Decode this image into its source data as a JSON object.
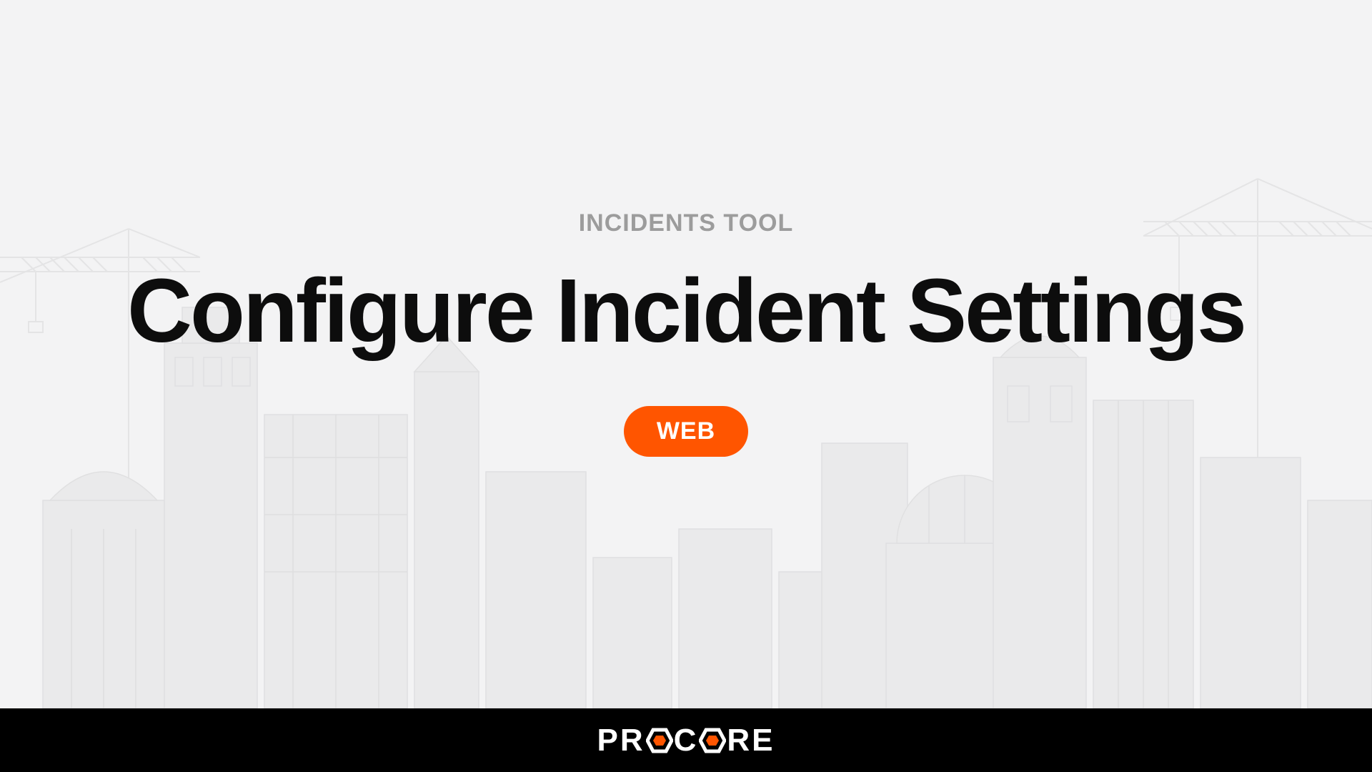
{
  "content": {
    "eyebrow": "INCIDENTS TOOL",
    "title": "Configure Incident Settings",
    "badge": "WEB"
  },
  "footer": {
    "brand_part1": "PR",
    "brand_part2": "C",
    "brand_part3": "RE"
  },
  "colors": {
    "accent": "#ff5500",
    "background": "#f3f3f4",
    "footer_bg": "#000000"
  }
}
